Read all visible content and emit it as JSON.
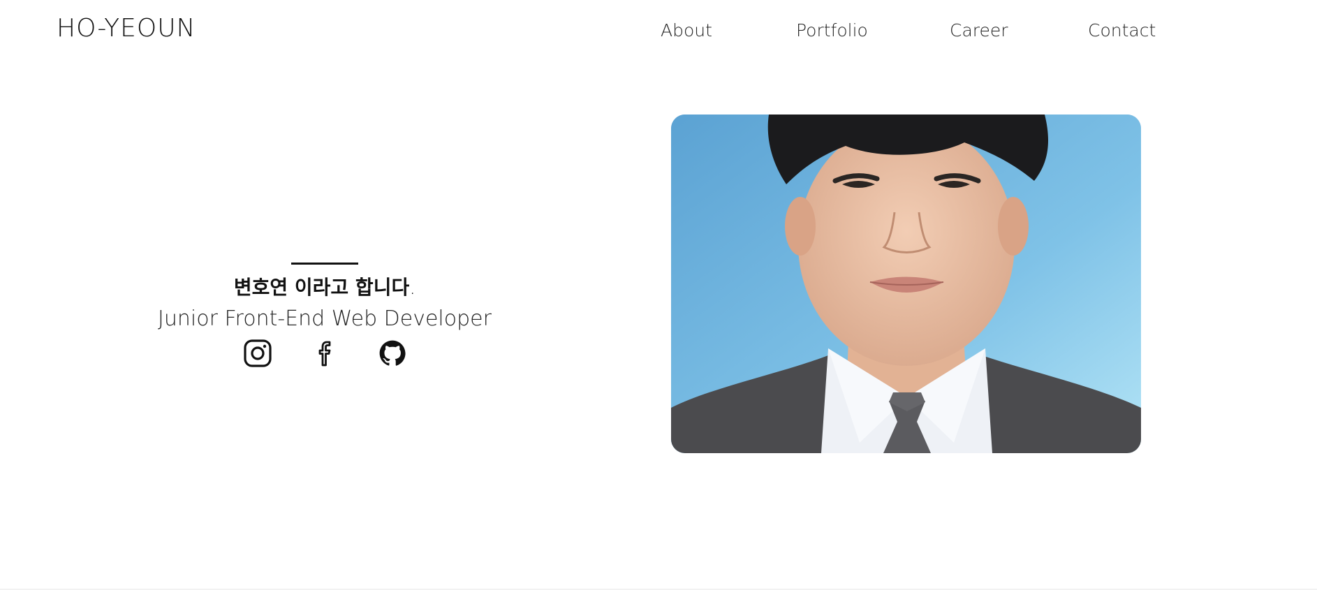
{
  "header": {
    "logo": "HO-YEOUN",
    "nav": [
      {
        "label": "About"
      },
      {
        "label": "Portfolio"
      },
      {
        "label": "Career"
      },
      {
        "label": "Contact"
      }
    ]
  },
  "intro": {
    "name_text": "변호연 이라고 합니다",
    "name_period": ".",
    "role": "Junior Front-End Web Developer",
    "social": [
      {
        "icon": "instagram-icon"
      },
      {
        "icon": "facebook-icon"
      },
      {
        "icon": "github-icon"
      }
    ]
  },
  "profile_photo": {
    "background_color": "#6fb6e2",
    "suit_color": "#4a4a4c",
    "shirt_color": "#eef1f6"
  }
}
